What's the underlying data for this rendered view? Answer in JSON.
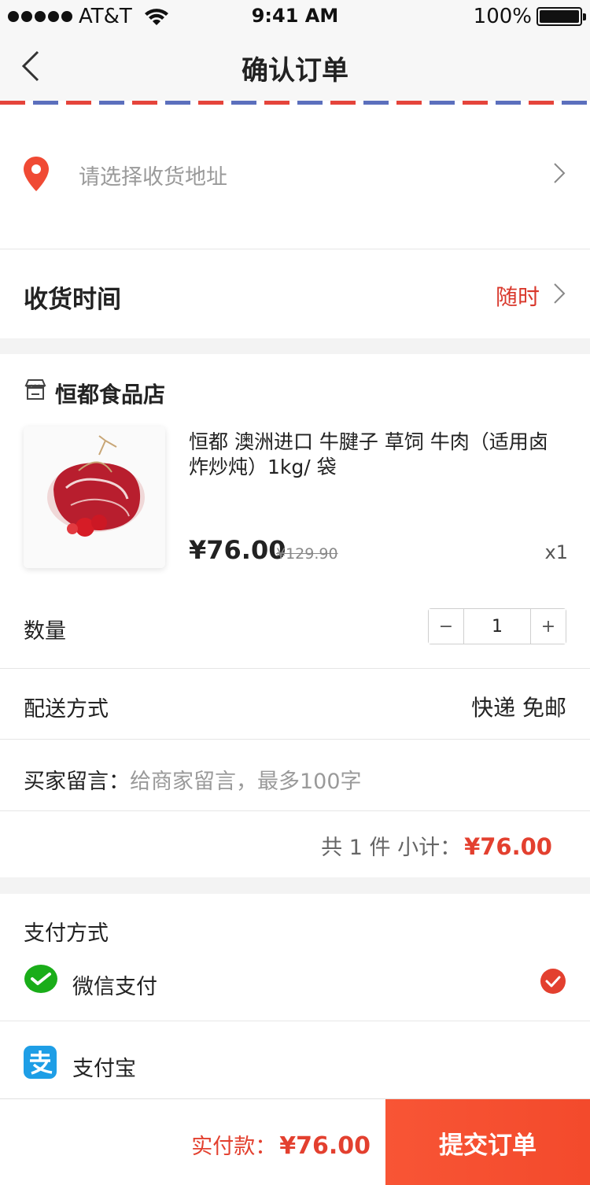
{
  "status_bar": {
    "carrier": "AT&T",
    "time": "9:41 AM",
    "battery": "100%"
  },
  "nav": {
    "title": "确认订单",
    "back_icon": "chevron-left-icon"
  },
  "address": {
    "placeholder": "请选择收货地址",
    "icon": "location-pin-icon"
  },
  "delivery_time": {
    "label": "收货时间",
    "value": "随时"
  },
  "store": {
    "name": "恒都食品店",
    "icon": "store-icon",
    "product": {
      "name": "恒都 澳洲进口 牛腱子 草饲 牛肉（适用卤炸炒炖）1kg/ 袋",
      "price": "¥76.00",
      "original_price": "¥129.90",
      "quantity_label": "x1"
    }
  },
  "quantity": {
    "label": "数量",
    "value": "1",
    "minus": "−",
    "plus": "+"
  },
  "shipping": {
    "label": "配送方式",
    "value": "快递 免邮"
  },
  "memo": {
    "label": "买家留言：",
    "placeholder": "给商家留言，最多100字"
  },
  "subtotal": {
    "count_text": "共 1 件 小计：",
    "amount": "¥76.00"
  },
  "payment": {
    "title": "支付方式",
    "options": [
      {
        "label": "微信支付",
        "icon": "wechat-pay-icon",
        "selected": true
      },
      {
        "label": "支付宝",
        "icon": "alipay-icon",
        "selected": false
      }
    ]
  },
  "footer": {
    "total_label": "实付款：",
    "total_amount": "¥76.00",
    "submit_label": "提交订单"
  },
  "colors": {
    "accent": "#e3402f",
    "submit_button": "#f64f31",
    "wechat_green": "#1aad19",
    "alipay_blue": "#1e9ee6"
  }
}
